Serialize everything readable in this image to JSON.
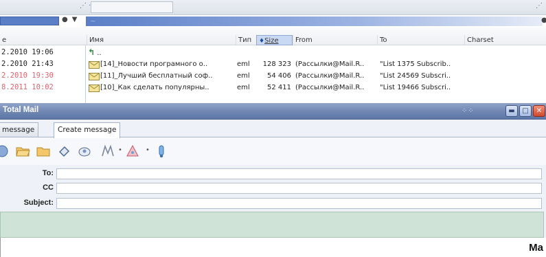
{
  "file_panel": {
    "columns": {
      "name": "Имя",
      "type": "Тип",
      "size": "Size",
      "from": "From",
      "to": "To",
      "charset": "Charset",
      "left_stub": "e"
    },
    "up_row": "..",
    "dates": [
      {
        "text": "2.2010 19:06",
        "highlight": false
      },
      {
        "text": "2.2010 21:43",
        "highlight": false
      },
      {
        "text": "2.2010 19:30",
        "highlight": true
      },
      {
        "text": "8.2011 10:02",
        "highlight": true
      }
    ],
    "files": [
      {
        "name": "[14]_Новости програмного о..",
        "type": "eml",
        "size": "128 323",
        "from": "(Рассылки@Mail.R..",
        "to": "\"List 1375 Subscrib.."
      },
      {
        "name": "[11]_Лучший бесплатный соф..",
        "type": "eml",
        "size": "54 406",
        "from": "(Рассылки@Mail.R..",
        "to": "\"List 24569 Subscri.."
      },
      {
        "name": "[10]_Как сделать популярны..",
        "type": "eml",
        "size": "52 411",
        "from": "(Рассылки@Mail.R..",
        "to": "\"List 19466 Subscri.."
      }
    ]
  },
  "total_mail": {
    "title": "Total Mail",
    "tabs": [
      {
        "label": "message",
        "active": false
      },
      {
        "label": "Create message",
        "active": true
      }
    ],
    "toolbar_icons": [
      "send-icon",
      "open-folder-icon",
      "folder-icon",
      "attach-icon",
      "address-book-icon",
      "signature-icon",
      "priority-icon",
      "encrypt-icon"
    ],
    "fields": {
      "to_label": "To:",
      "cc_label": "CC",
      "subject_label": "Subject:"
    }
  },
  "caption": "Ma",
  "colors": {
    "title_bar": "#6f86b2",
    "selection": "#5b7fc7",
    "editor_bg": "#cfe3d6",
    "date_highlight": "#e06570"
  }
}
